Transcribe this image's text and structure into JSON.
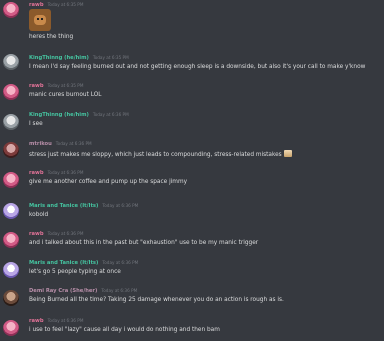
{
  "colors": {
    "background": "#36393f",
    "rawb": "#e07297",
    "king": "#45c4a0",
    "mtrikou": "#b78ea8",
    "maris": "#45c4a0",
    "demi": "#b78ea8",
    "timestamp": "#72767d",
    "text": "#dcddde"
  },
  "messages": [
    {
      "author": "rawb",
      "time": "Today at 6:35 PM",
      "text": "heres the thing",
      "has_sticker": true
    },
    {
      "author": "KingThinng (he/him)",
      "time": "Today at 6:35 PM",
      "text": "I mean I'd say feeling burned out and not getting enough sleep is a downside, but also it's your call to make y'know"
    },
    {
      "author": "rawb",
      "time": "Today at 6:35 PM",
      "text": "manic cures burnout LOL"
    },
    {
      "author": "KingThinng (he/him)",
      "time": "Today at 6:36 PM",
      "text": "I see"
    },
    {
      "author": "mtrikou",
      "time": "Today at 6:36 PM",
      "text": "stress just makes me sloppy, which just leads to compounding, stress-related mistakes"
    },
    {
      "author": "rawb",
      "time": "Today at 6:36 PM",
      "text": "give me another coffee and pump up the space jimmy"
    },
    {
      "author": "Maris and Tanice (It/Its)",
      "time": "Today at 6:36 PM",
      "text": "kobold"
    },
    {
      "author": "rawb",
      "time": "Today at 6:36 PM",
      "text": "and i talked about this in the past but \"exhaustion\" use to be my manic trigger"
    },
    {
      "author": "Maris and Tanice (It/Its)",
      "time": "Today at 6:36 PM",
      "text": "let's go 5 people typing at once"
    },
    {
      "author": "Demi Ray Cra (She/her)",
      "time": "Today at 6:36 PM",
      "text": "Being Burned all the time? Taking 25 damage whenever you do an action is rough as is."
    },
    {
      "author": "rawb",
      "time": "Today at 6:36 PM",
      "text": "i use to feel \"lazy\" cause all day i would do nothing and then bam"
    }
  ]
}
